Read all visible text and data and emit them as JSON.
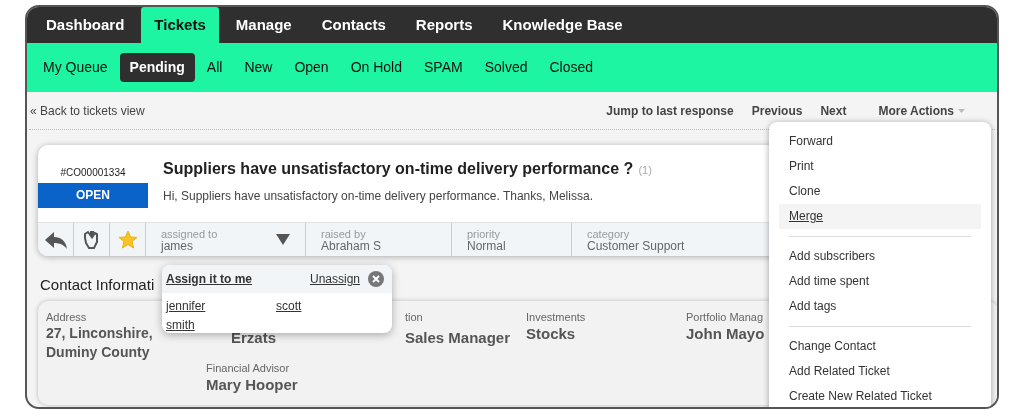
{
  "top_nav": [
    {
      "label": "Dashboard",
      "selected": false
    },
    {
      "label": "Tickets",
      "selected": true
    },
    {
      "label": "Manage",
      "selected": false
    },
    {
      "label": "Contacts",
      "selected": false
    },
    {
      "label": "Reports",
      "selected": false
    },
    {
      "label": "Knowledge Base",
      "selected": false
    }
  ],
  "sub_nav": [
    {
      "label": "My Queue",
      "selected": false
    },
    {
      "label": "Pending",
      "selected": true
    },
    {
      "label": "All",
      "selected": false
    },
    {
      "label": "New",
      "selected": false
    },
    {
      "label": "Open",
      "selected": false
    },
    {
      "label": "On Hold",
      "selected": false
    },
    {
      "label": "SPAM",
      "selected": false
    },
    {
      "label": "Solved",
      "selected": false
    },
    {
      "label": "Closed",
      "selected": false
    }
  ],
  "back_link": "« Back to tickets view",
  "actions": [
    "Jump to last response",
    "Previous",
    "Next"
  ],
  "more_actions": {
    "label": "More Actions",
    "expanded": true,
    "groups": [
      [
        {
          "label": "Forward",
          "selected": false
        },
        {
          "label": "Print",
          "selected": false
        },
        {
          "label": "Clone",
          "selected": false
        },
        {
          "label": "Merge",
          "selected": true
        }
      ],
      [
        {
          "label": "Add subscribers",
          "selected": false
        },
        {
          "label": "Add time spent",
          "selected": false
        },
        {
          "label": "Add tags",
          "selected": false
        }
      ],
      [
        {
          "label": "Change Contact",
          "selected": false
        },
        {
          "label": "Add Related Ticket",
          "selected": false
        },
        {
          "label": "Create New Related Ticket",
          "selected": false
        }
      ]
    ]
  },
  "ticket": {
    "id": "#CO00001334",
    "status": "OPEN",
    "title": "Suppliers have unsatisfactory on-time delivery performance ?",
    "count": "(1)",
    "preview": "Hi, Suppliers have unsatisfactory on-time delivery performance. Thanks, Melissa.",
    "starred": true,
    "fields": [
      {
        "label": "assigned to",
        "value": "james",
        "kind": "dropdown"
      },
      {
        "label": "raised by",
        "value": "Abraham S",
        "kind": "plain"
      },
      {
        "label": "priority",
        "value": "Normal",
        "kind": "plain"
      },
      {
        "label": "category",
        "value": "Customer Support",
        "kind": "plain"
      }
    ]
  },
  "assign_popup": {
    "assign_me": "Assign it to me",
    "unassign": "Unassign",
    "users": [
      "jennifer",
      "scott",
      "smith"
    ]
  },
  "contact": {
    "heading": "Contact Informati",
    "fields": [
      {
        "label": "Address",
        "value": "27, Linconshire, Duminy County"
      },
      {
        "value": "Erzats"
      },
      {
        "label": "tion",
        "value": "Sales Manager"
      },
      {
        "label": "Investments",
        "value": "Stocks"
      },
      {
        "label": "Portfolio Manag",
        "value": "John Mayo"
      },
      {
        "label": "Financial Advisor",
        "value": "Mary Hooper"
      }
    ]
  }
}
